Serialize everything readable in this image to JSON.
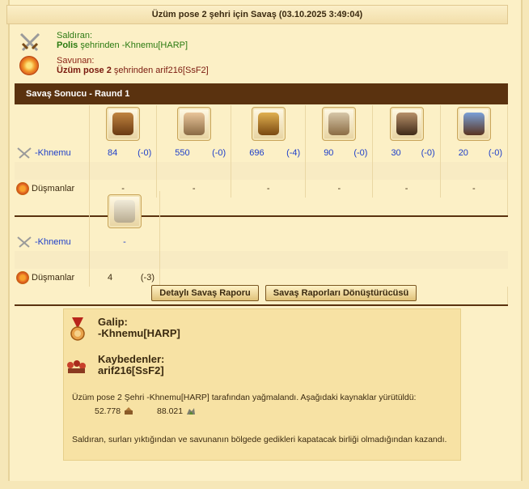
{
  "title": "Üzüm pose 2 şehri için Savaş (03.10.2025 3:49:04)",
  "attacker": {
    "label": "Saldıran:",
    "city": "Polis",
    "suffix": "şehrinden -Khnemu[HARP]"
  },
  "defender": {
    "label": "Savunan:",
    "city": "Üzüm pose 2",
    "suffix": "şehrinden arif216[SsF2]"
  },
  "round_title": "Savaş Sonucu - Raund 1",
  "units_attack": [
    {
      "icon": "slinger-icon",
      "count": "84",
      "loss": "(-0)"
    },
    {
      "icon": "swordsman-icon",
      "count": "550",
      "loss": "(-0)"
    },
    {
      "icon": "hoplite-icon",
      "count": "696",
      "loss": "(-4)"
    },
    {
      "icon": "catapult-icon",
      "count": "90",
      "loss": "(-0)"
    },
    {
      "icon": "siege-ram-icon",
      "count": "30",
      "loss": "(-0)"
    },
    {
      "icon": "hero-icon",
      "count": "20",
      "loss": "(-0)"
    }
  ],
  "attacker_row_label": "-Khnemu",
  "defender_row_label": "Düşmanlar",
  "dash": "-",
  "wall": {
    "icon": "city-wall-icon",
    "att": "-",
    "count": "4",
    "loss": "(-3)"
  },
  "buttons": {
    "detail": "Detaylı Savaş Raporu",
    "converter": "Savaş Raporları Dönüştürücüsü"
  },
  "result": {
    "winner_label": "Galip:",
    "winner": "-Khnemu[HARP]",
    "loser_label": "Kaybedenler:",
    "loser": "arif216[SsF2]",
    "plunder_text": "Üzüm pose 2 Şehri -Khnemu[HARP] tarafından yağmalandı. Aşağıdaki kaynaklar yürütüldü:",
    "res1": "52.778",
    "res2": "88.021",
    "note": "Saldıran, surları yıktığından ve savunanın bölgede gedikleri kapatacak birliği olmadığından kazandı."
  }
}
